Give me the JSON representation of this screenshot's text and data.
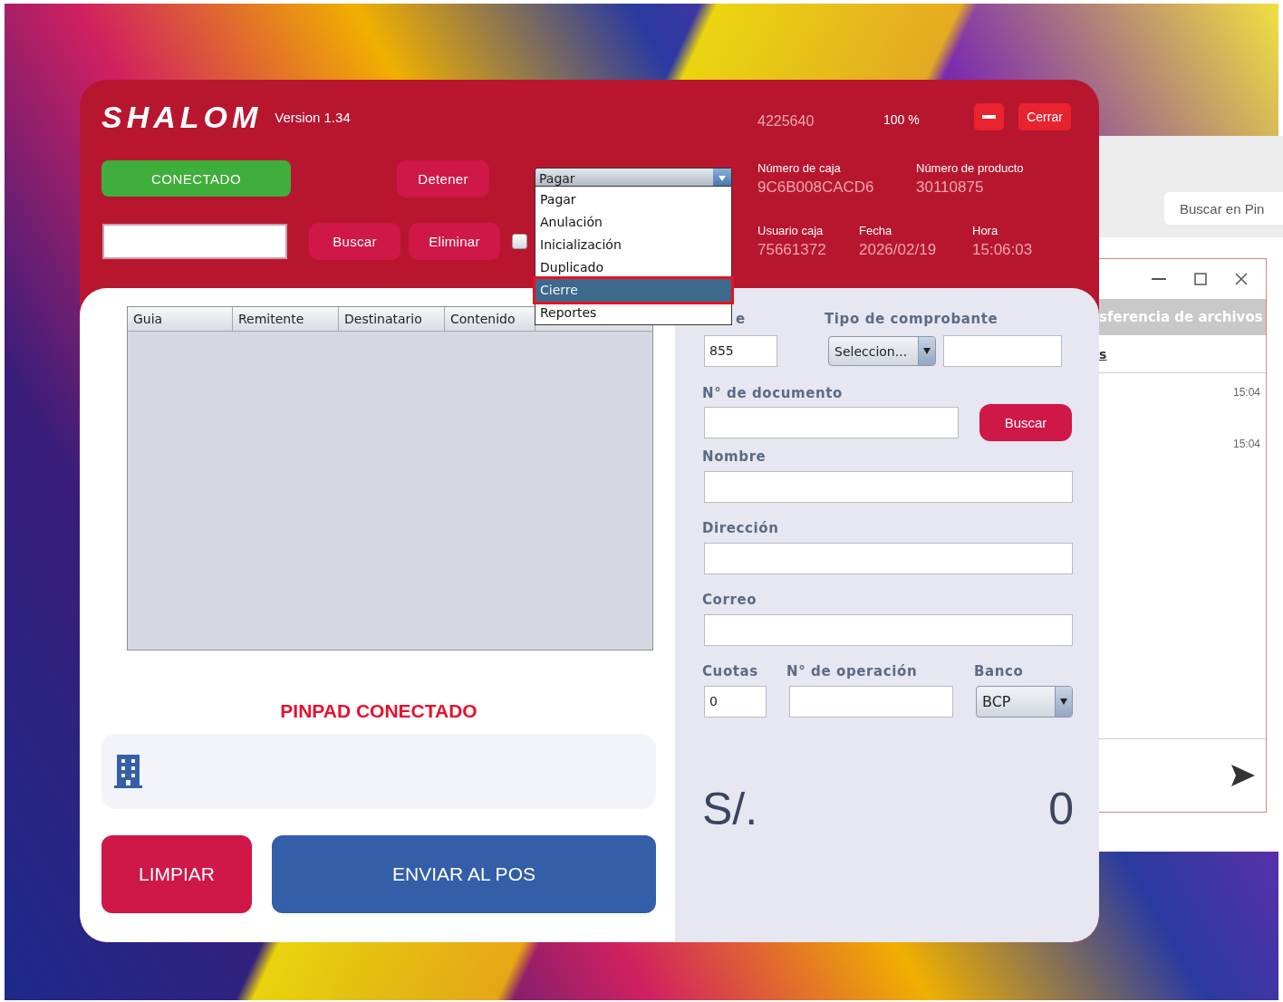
{
  "app": {
    "logo": "SHALOM",
    "version": "Version 1.34",
    "counter": "4225640",
    "percent": "100 %",
    "close_button": "Cerrar",
    "connection_button": "CONECTADO",
    "stop_button": "Detener",
    "operation": {
      "value": "Pagar",
      "options": [
        {
          "label": "Pagar",
          "highlighted": false
        },
        {
          "label": "Anulación",
          "highlighted": false
        },
        {
          "label": "Inicialización",
          "highlighted": false
        },
        {
          "label": "Duplicado",
          "highlighted": false
        },
        {
          "label": "Cierre",
          "highlighted": true
        },
        {
          "label": "Reportes",
          "highlighted": false
        }
      ]
    },
    "search_button": "Buscar",
    "delete_button": "Eliminar",
    "checkbox": {
      "checked": false
    },
    "info": [
      {
        "label": "Número de caja",
        "value": "9C6B008CACD6"
      },
      {
        "label": "Número de producto",
        "value": "30110875"
      },
      {
        "label": "Usuario caja",
        "value": "75661372"
      },
      {
        "label": "Fecha",
        "value": "2026/02/19"
      },
      {
        "label": "Hora",
        "value": "15:06:03"
      }
    ],
    "table": {
      "columns": [
        "Guia",
        "Remitente",
        "Destinatario",
        "Contenido"
      ]
    },
    "pinpad_status": "PINPAD CONECTADO",
    "clear_button": "LIMPIAR",
    "send_button": "ENVIAR AL POS",
    "form": {
      "code_label": "e",
      "code_value": "855",
      "voucher_label": "Tipo de comprobante",
      "voucher_type": "Seleccion...",
      "document_label": "N° de documento",
      "document_button": "Buscar",
      "name_label": "Nombre",
      "address_label": "Dirección",
      "email_label": "Correo",
      "installments_label": "Cuotas",
      "installments_value": "0",
      "operation_label": "N° de operación",
      "bank_label": "Banco",
      "bank_value": "BCP",
      "currency": "S/.",
      "amount": "0"
    }
  },
  "background_window": {
    "search_placeholder": "Buscar en Pin",
    "transfer_title": "sferencia de archivos",
    "tab_label": "s",
    "times": [
      "15:04",
      "15:04"
    ]
  }
}
